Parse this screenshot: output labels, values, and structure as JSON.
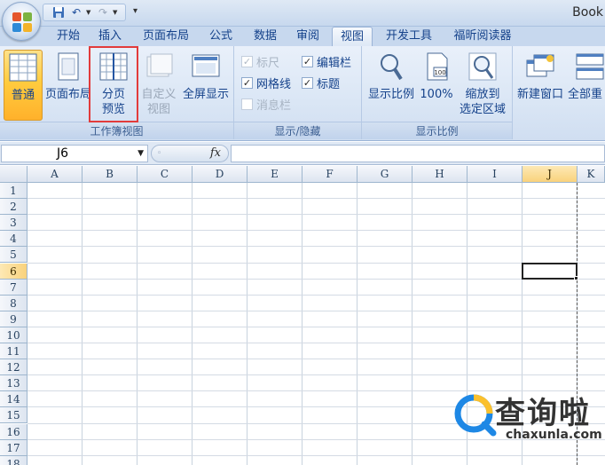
{
  "title_bar": {
    "app_title": "Book"
  },
  "tabs": [
    {
      "label": "开始"
    },
    {
      "label": "插入"
    },
    {
      "label": "页面布局"
    },
    {
      "label": "公式"
    },
    {
      "label": "数据"
    },
    {
      "label": "审阅"
    },
    {
      "label": "视图"
    },
    {
      "label": "开发工具"
    },
    {
      "label": "福昕阅读器"
    }
  ],
  "active_tab": "视图",
  "ribbon": {
    "workbook_views": {
      "label": "工作簿视图",
      "normal": "普通",
      "page_layout": "页面布局",
      "page_break_line1": "分页",
      "page_break_line2": "预览",
      "custom_line1": "自定义",
      "custom_line2": "视图",
      "fullscreen": "全屏显示"
    },
    "show_hide": {
      "label": "显示/隐藏",
      "ruler": {
        "label": "标尺",
        "checked": true,
        "enabled": false
      },
      "formula_bar": {
        "label": "编辑栏",
        "checked": true,
        "enabled": true
      },
      "gridlines": {
        "label": "网格线",
        "checked": true,
        "enabled": true
      },
      "headings": {
        "label": "标题",
        "checked": true,
        "enabled": true
      },
      "message_bar": {
        "label": "消息栏",
        "checked": false,
        "enabled": false
      }
    },
    "zoom": {
      "label": "显示比例",
      "zoom": "显示比例",
      "hundred": "100%",
      "zoom_sel_line1": "缩放到",
      "zoom_sel_line2": "选定区域"
    },
    "window": {
      "new_window": "新建窗口",
      "arrange_all": "全部重"
    }
  },
  "formula_bar": {
    "name_box": "J6",
    "fx": "fx",
    "formula": ""
  },
  "sheet": {
    "columns": [
      "A",
      "B",
      "C",
      "D",
      "E",
      "F",
      "G",
      "H",
      "I",
      "J",
      "K"
    ],
    "rows": [
      "1",
      "2",
      "3",
      "4",
      "5",
      "6",
      "7",
      "8",
      "9",
      "10",
      "11",
      "12",
      "13",
      "14",
      "15",
      "16",
      "17",
      "18"
    ],
    "active_cell": "J6",
    "selected_column": "J",
    "selected_row": "6"
  },
  "watermark": {
    "brand": "查询啦",
    "url": "chaxunla.com"
  },
  "colors": {
    "accent": "#15428b",
    "highlight_box": "#e23b3b",
    "active_button": "#ffcc3f"
  }
}
